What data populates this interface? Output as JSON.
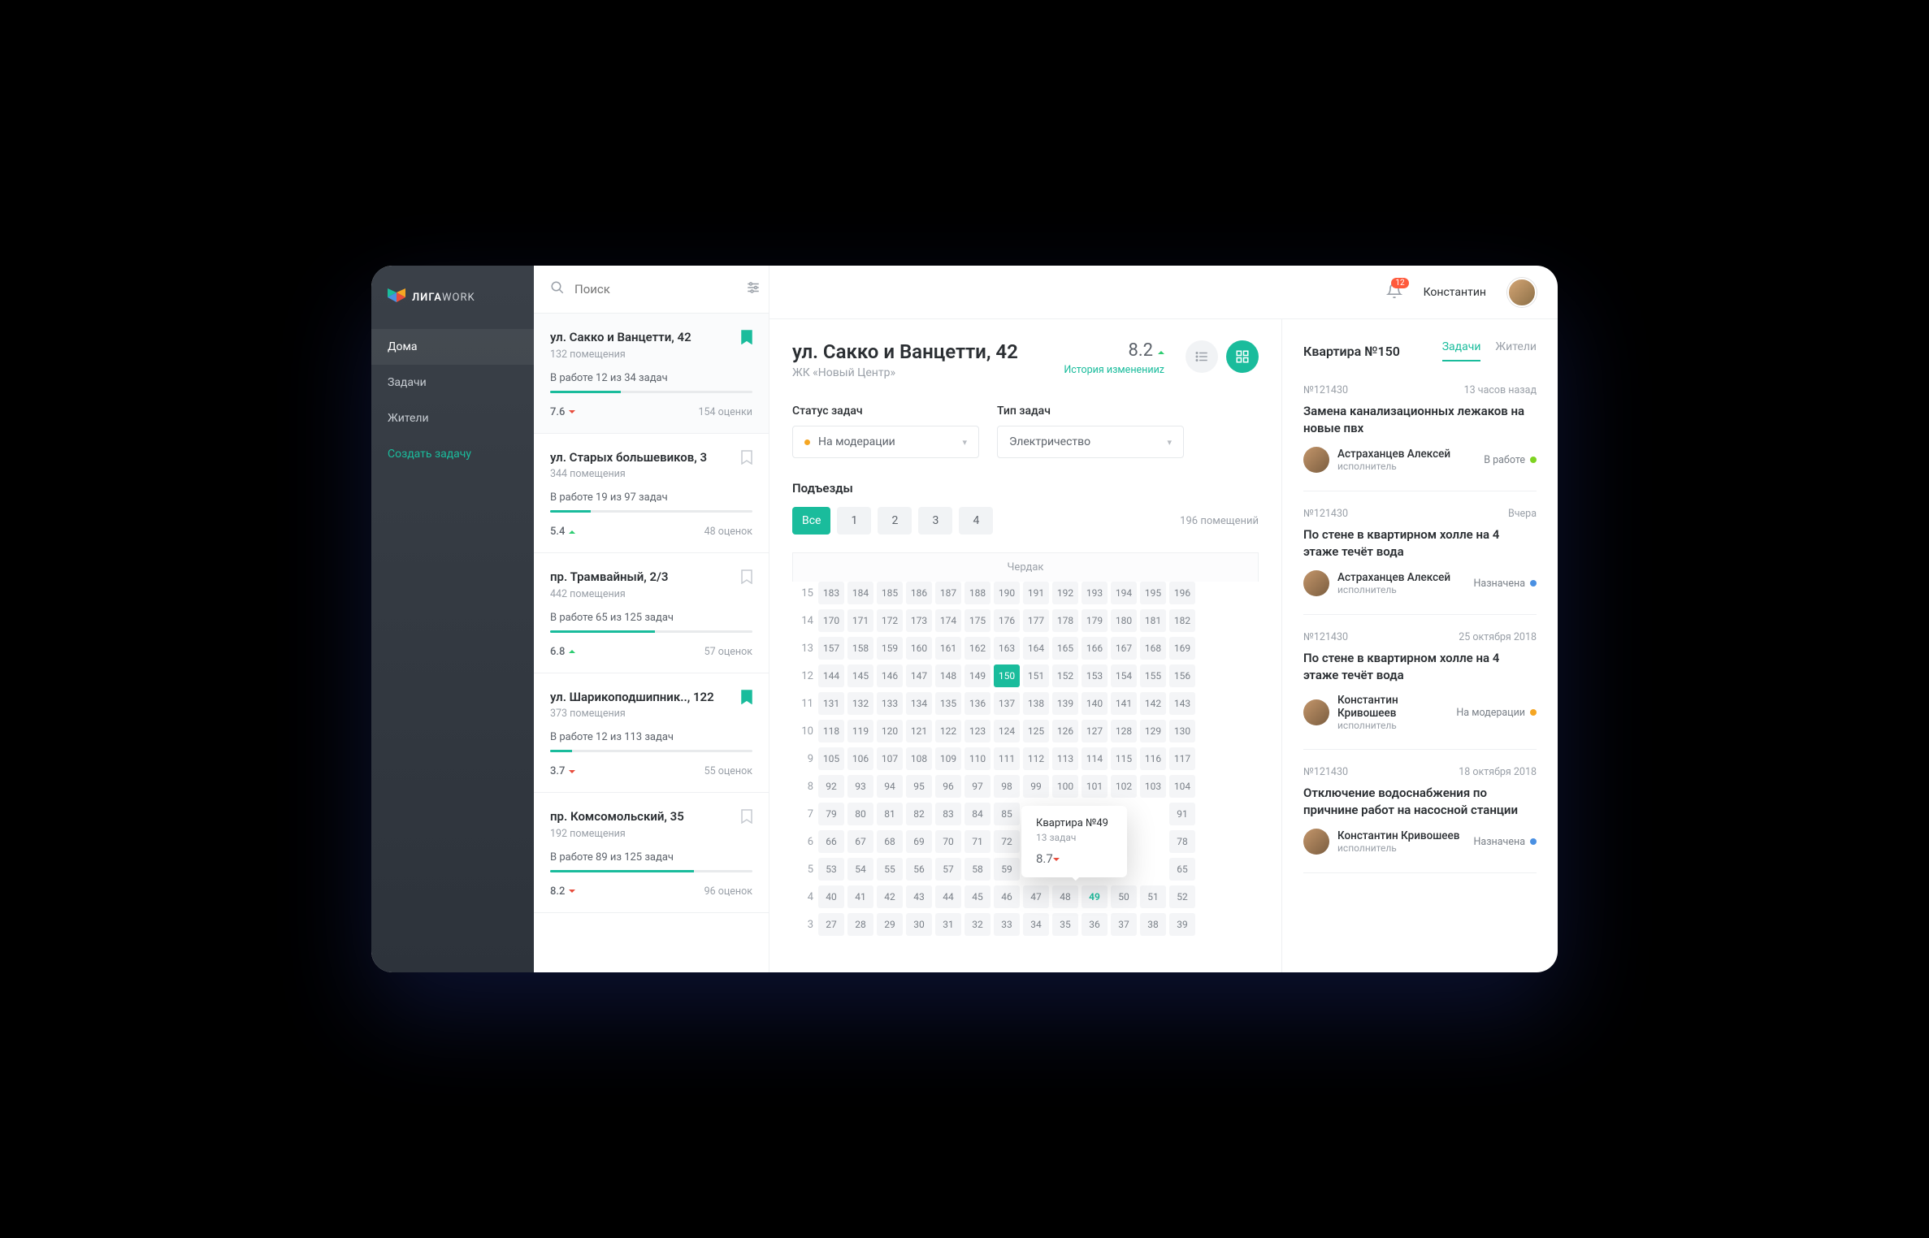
{
  "logo": {
    "brand1": "ЛИГА",
    "brand2": "WORK"
  },
  "nav": {
    "items": [
      "Дома",
      "Задачи",
      "Жители"
    ],
    "create": "Создать задачу"
  },
  "search": {
    "placeholder": "Поиск"
  },
  "topbar": {
    "notifications": "12",
    "username": "Константин"
  },
  "houses": [
    {
      "title": "ул. Сакко и Ванцетти, 42",
      "rooms": "132 помещения",
      "status": "В работе 12 из 34 задач",
      "progress": 35,
      "score": "7.6",
      "trend": "down",
      "reviews": "154 оценки",
      "bookmarked": true
    },
    {
      "title": "ул. Старых большевиков, 3",
      "rooms": "344 помещения",
      "status": "В работе 19 из 97 задач",
      "progress": 20,
      "score": "5.4",
      "trend": "up",
      "reviews": "48 оценок",
      "bookmarked": false
    },
    {
      "title": "пр. Трамвайный, 2/3",
      "rooms": "442 помещения",
      "status": "В работе 65 из 125 задач",
      "progress": 52,
      "score": "6.8",
      "trend": "up",
      "reviews": "57 оценок",
      "bookmarked": false
    },
    {
      "title": "ул. Шарикоподшипник.., 122",
      "rooms": "373 помещения",
      "status": "В работе 12 из 113 задач",
      "progress": 11,
      "score": "3.7",
      "trend": "down",
      "reviews": "55 оценок",
      "bookmarked": true
    },
    {
      "title": "пр. Комсомольский, 35",
      "rooms": "192 помещения",
      "status": "В работе 89 из 125 задач",
      "progress": 71,
      "score": "8.2",
      "trend": "down",
      "reviews": "96 оценок",
      "bookmarked": false
    }
  ],
  "center": {
    "address": "ул. Сакко и Ванцетти, 42",
    "complex": "ЖК «Новый Центр»",
    "rating": "8.2",
    "rating_trend": "up",
    "history": "История измененииz",
    "filter_status": {
      "label": "Статус задач",
      "value": "На модерации"
    },
    "filter_type": {
      "label": "Тип задач",
      "value": "Электричество"
    },
    "entrances": {
      "label": "Подъезды",
      "all": "Все",
      "items": [
        "1",
        "2",
        "3",
        "4"
      ],
      "count": "196 помещений"
    },
    "attic": "Чердак",
    "floors": [
      {
        "num": "15",
        "apts": [
          "183",
          "184",
          "185",
          "186",
          "187",
          "188",
          "190",
          "191",
          "192",
          "193",
          "194",
          "195",
          "196"
        ]
      },
      {
        "num": "14",
        "apts": [
          "170",
          "171",
          "172",
          "173",
          "174",
          "175",
          "176",
          "177",
          "178",
          "179",
          "180",
          "181",
          "182"
        ]
      },
      {
        "num": "13",
        "apts": [
          "157",
          "158",
          "159",
          "160",
          "161",
          "162",
          "163",
          "164",
          "165",
          "166",
          "167",
          "168",
          "169"
        ]
      },
      {
        "num": "12",
        "apts": [
          "144",
          "145",
          "146",
          "147",
          "148",
          "149",
          "150",
          "151",
          "152",
          "153",
          "154",
          "155",
          "156"
        ]
      },
      {
        "num": "11",
        "apts": [
          "131",
          "132",
          "133",
          "134",
          "135",
          "136",
          "137",
          "138",
          "139",
          "140",
          "141",
          "142",
          "143"
        ]
      },
      {
        "num": "10",
        "apts": [
          "118",
          "119",
          "120",
          "121",
          "122",
          "123",
          "124",
          "125",
          "126",
          "127",
          "128",
          "129",
          "130"
        ]
      },
      {
        "num": "9",
        "apts": [
          "105",
          "106",
          "107",
          "108",
          "109",
          "110",
          "111",
          "112",
          "113",
          "114",
          "115",
          "116",
          "117"
        ]
      },
      {
        "num": "8",
        "apts": [
          "92",
          "93",
          "94",
          "95",
          "96",
          "97",
          "98",
          "99",
          "100",
          "101",
          "102",
          "103",
          "104"
        ]
      },
      {
        "num": "7",
        "apts": [
          "79",
          "80",
          "81",
          "82",
          "83",
          "84",
          "85",
          "",
          "",
          "",
          "",
          "",
          "91"
        ]
      },
      {
        "num": "6",
        "apts": [
          "66",
          "67",
          "68",
          "69",
          "70",
          "71",
          "72",
          "",
          "",
          "",
          "",
          "",
          "78"
        ]
      },
      {
        "num": "5",
        "apts": [
          "53",
          "54",
          "55",
          "56",
          "57",
          "58",
          "59",
          "",
          "",
          "",
          "",
          "",
          "65"
        ]
      },
      {
        "num": "4",
        "apts": [
          "40",
          "41",
          "42",
          "43",
          "44",
          "45",
          "46",
          "47",
          "48",
          "49",
          "50",
          "51",
          "52"
        ]
      },
      {
        "num": "3",
        "apts": [
          "27",
          "28",
          "29",
          "30",
          "31",
          "32",
          "33",
          "34",
          "35",
          "36",
          "37",
          "38",
          "39"
        ]
      }
    ],
    "tooltip": {
      "title": "Квартира №49",
      "sub": "13 задач",
      "score": "8.7"
    },
    "active_apt": "150",
    "hover_apt": "49"
  },
  "panel": {
    "title": "Квартира №150",
    "tabs": [
      "Задачи",
      "Жители"
    ],
    "tasks": [
      {
        "id": "№121430",
        "time": "13 часов назад",
        "title": "Замена канализационных лежаков на новые пвх",
        "assignee": "Астраханцев Алексей",
        "role": "исполнитель",
        "status": "В работе",
        "dot": "green"
      },
      {
        "id": "№121430",
        "time": "Вчера",
        "title": "По стене в квартирном холле на 4 этаже течёт вода",
        "assignee": "Астраханцев Алексей",
        "role": "исполнитель",
        "status": "Назначена",
        "dot": "blue"
      },
      {
        "id": "№121430",
        "time": "25 октября 2018",
        "title": "По стене в квартирном холле на 4 этаже течёт вода",
        "assignee": "Константин Кривошеев",
        "role": "исполнитель",
        "status": "На модерации",
        "dot": "yellow"
      },
      {
        "id": "№121430",
        "time": "18 октября 2018",
        "title": "Отключение водоснабжения по причнине работ на насосной станции",
        "assignee": "Константин Кривошеев",
        "role": "исполнитель",
        "status": "Назначена",
        "dot": "blue"
      }
    ]
  }
}
